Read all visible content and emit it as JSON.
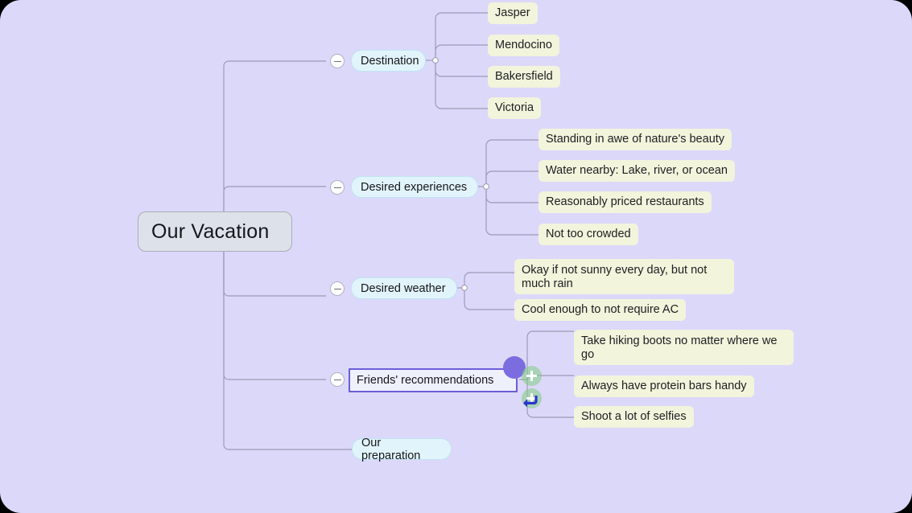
{
  "canvas": {
    "background_color": "#dcd8f9",
    "outer_background_color": "#000000"
  },
  "colors": {
    "root_fill": "#dde2ea",
    "branch_fill": "#e2f4fb",
    "leaf_fill": "#f2f4dc",
    "selection_border": "#6b5ddb",
    "drag_handle": "#7b6cdf",
    "add_button": "#80ce80",
    "connector": "#9d98b5"
  },
  "root": {
    "label": "Our Vacation"
  },
  "branches": [
    {
      "label": "Destination",
      "collapse_icon": "minus-circle-icon",
      "collapsible": true,
      "selected": false,
      "children": [
        {
          "label": "Jasper"
        },
        {
          "label": "Mendocino"
        },
        {
          "label": "Bakersfield"
        },
        {
          "label": "Victoria"
        }
      ]
    },
    {
      "label": "Desired experiences",
      "collapse_icon": "minus-circle-icon",
      "collapsible": true,
      "selected": false,
      "children": [
        {
          "label": "Standing in awe of nature's beauty"
        },
        {
          "label": "Water nearby: Lake, river, or ocean"
        },
        {
          "label": "Reasonably priced restaurants"
        },
        {
          "label": "Not too crowded"
        }
      ]
    },
    {
      "label": "Desired weather",
      "collapse_icon": "minus-circle-icon",
      "collapsible": true,
      "selected": false,
      "children": [
        {
          "label": "Okay if not sunny every day, but not much rain"
        },
        {
          "label": "Cool enough to not require AC"
        }
      ]
    },
    {
      "label": "Friends' recommendations",
      "collapse_icon": "minus-circle-icon",
      "collapsible": true,
      "selected": true,
      "children": [
        {
          "label": "Take hiking boots no matter where we go"
        },
        {
          "label": "Always have protein bars handy"
        },
        {
          "label": "Shoot a lot of selfies"
        }
      ]
    },
    {
      "label": "Our preparation",
      "collapsible": false,
      "selected": false,
      "children": []
    }
  ],
  "selection_controls": {
    "drag_handle_name": "drag-handle",
    "add_sibling_icon": "plus-icon",
    "add_child_icon": "plus-icon",
    "return_key_icon": "return-arrow-icon"
  }
}
